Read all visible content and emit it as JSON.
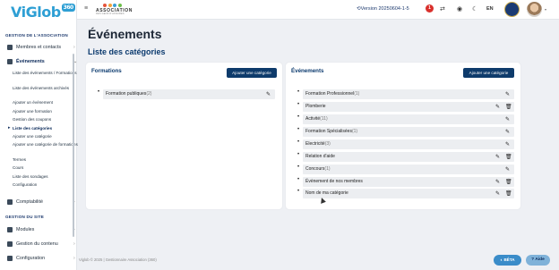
{
  "app": {
    "logo": "ViGlob",
    "logo_chip": "360",
    "logo_sub": "ASSOCIATION"
  },
  "topbar": {
    "asso_logo_title": "ASSOCIATION",
    "asso_logo_sub": "DES GENS D'AFFAIRES",
    "version": "Version 20250604-1-5",
    "notifications": "1",
    "language": "EN",
    "icons": [
      "menu-icon",
      "history-icon",
      "swap-icon",
      "eye-icon",
      "moon-icon"
    ]
  },
  "sidebar": {
    "section_asso": "GESTION DE L'ASSOCIATION",
    "item_members": "Membres et contacts",
    "item_events": "Événements",
    "events_sub": [
      "Liste des événements / Formations",
      "Liste des événements archivés",
      "Ajouter un événement",
      "Ajouter une formation",
      "Gestion des coupons",
      "Liste des catégories",
      "Ajouter une catégorie",
      "Ajouter une catégorie de formations",
      "Termes",
      "Cours",
      "Liste des sondages",
      "Configuration"
    ],
    "item_accounting": "Comptabilité",
    "section_site": "GESTION DU SITE",
    "item_modules": "Modules",
    "item_content": "Gestion du contenu",
    "item_config": "Configuration"
  },
  "main": {
    "page_title": "Événements",
    "section_title": "Liste des catégories",
    "formations": {
      "title": "Formations",
      "add_label": "Ajouter une catégorie",
      "items": [
        {
          "name": "Formation publiques",
          "count": "(2)"
        }
      ]
    },
    "evenements": {
      "title": "Événements",
      "add_label": "Ajouter une catégorie",
      "items": [
        {
          "name": "Formation Professionnel",
          "count": "(1)"
        },
        {
          "name": "Plomberie",
          "count": ""
        },
        {
          "name": "Activité",
          "count": "(11)"
        },
        {
          "name": "Formation Spécialisées",
          "count": "(1)"
        },
        {
          "name": "Electricité",
          "count": "(3)"
        },
        {
          "name": "Relation d'aide",
          "count": ""
        },
        {
          "name": "Concours",
          "count": "(1)"
        },
        {
          "name": "Évènement de nos membres",
          "count": ""
        },
        {
          "name": "Nom de ma catégorie",
          "count": ""
        }
      ]
    }
  },
  "footer": {
    "text": "Viglob © 2025 | Gestionnaire Association (360)",
    "beta": "BÊTA",
    "aide": "Aide"
  },
  "colors": {
    "primary": "#0e3b6b",
    "accent": "#2e9fd4",
    "notif": "#d9302c"
  }
}
